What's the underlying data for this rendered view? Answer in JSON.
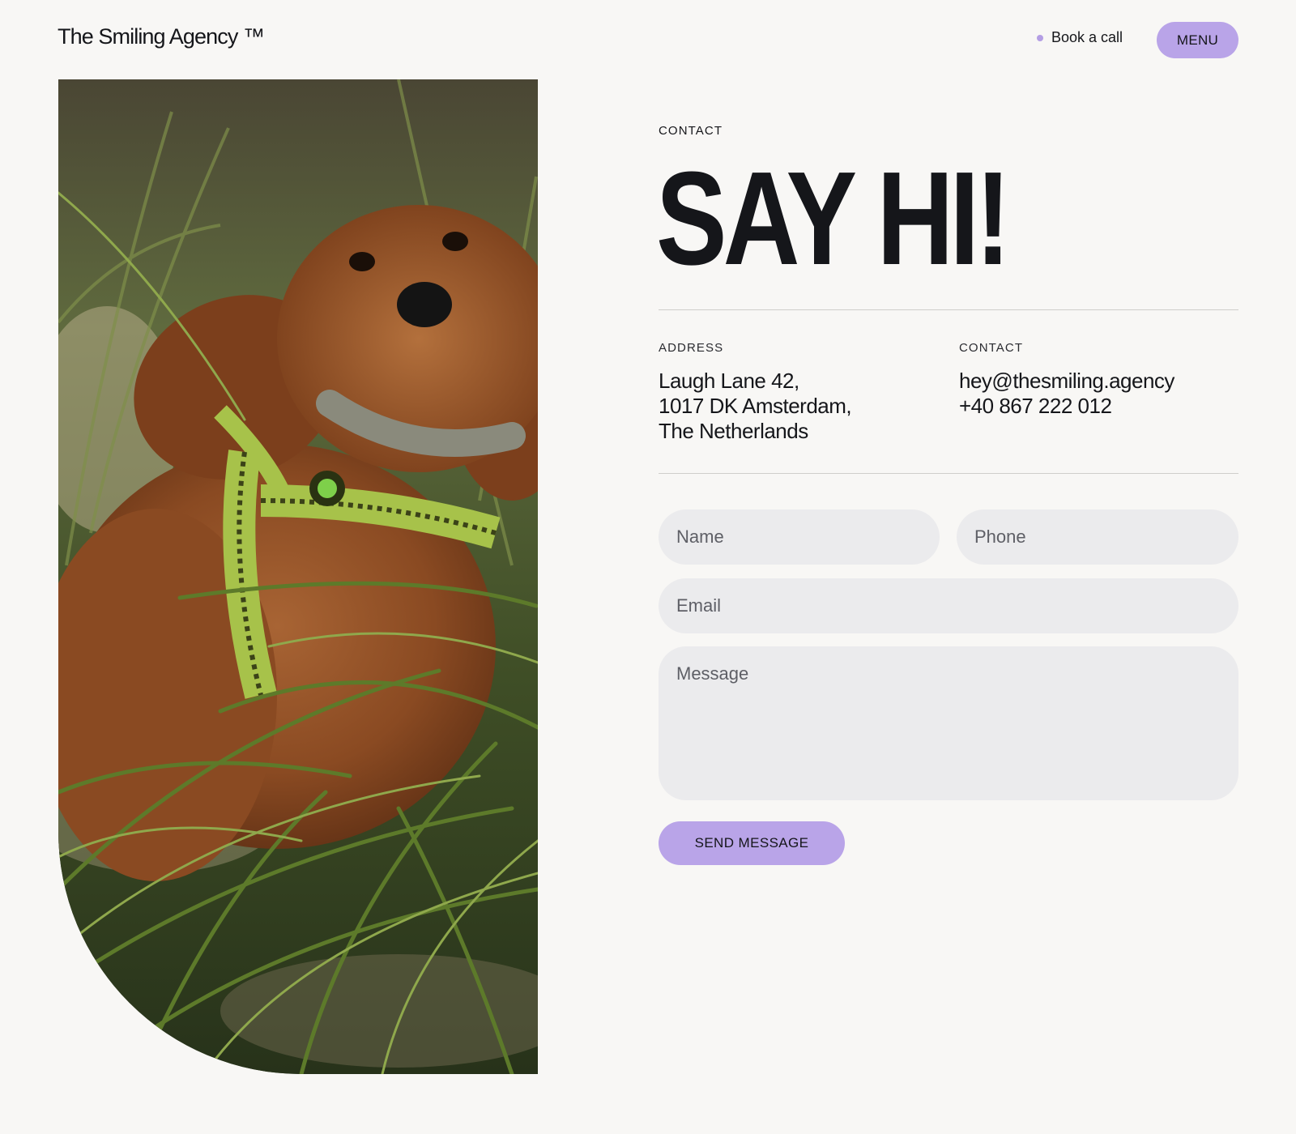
{
  "header": {
    "logo": "The Smiling Agency ™",
    "book_call_label": "Book a call",
    "menu_label": "MENU"
  },
  "hero": {
    "eyebrow": "CONTACT",
    "headline": "SAY HI!"
  },
  "info": {
    "address_label": "ADDRESS",
    "address_lines": [
      "Laugh Lane 42,",
      "1017 DK Amsterdam,",
      "The Netherlands"
    ],
    "contact_label": "CONTACT",
    "email": "hey@thesmiling.agency",
    "phone": "+40 867 222 012"
  },
  "form": {
    "name_placeholder": "Name",
    "phone_placeholder": "Phone",
    "email_placeholder": "Email",
    "message_placeholder": "Message",
    "submit_label": "SEND MESSAGE"
  },
  "colors": {
    "background": "#f8f7f5",
    "accent": "#b9a4e8",
    "text": "#15161a",
    "field": "#ebebed"
  },
  "icons": {
    "book_call_marker": "dot-icon"
  }
}
